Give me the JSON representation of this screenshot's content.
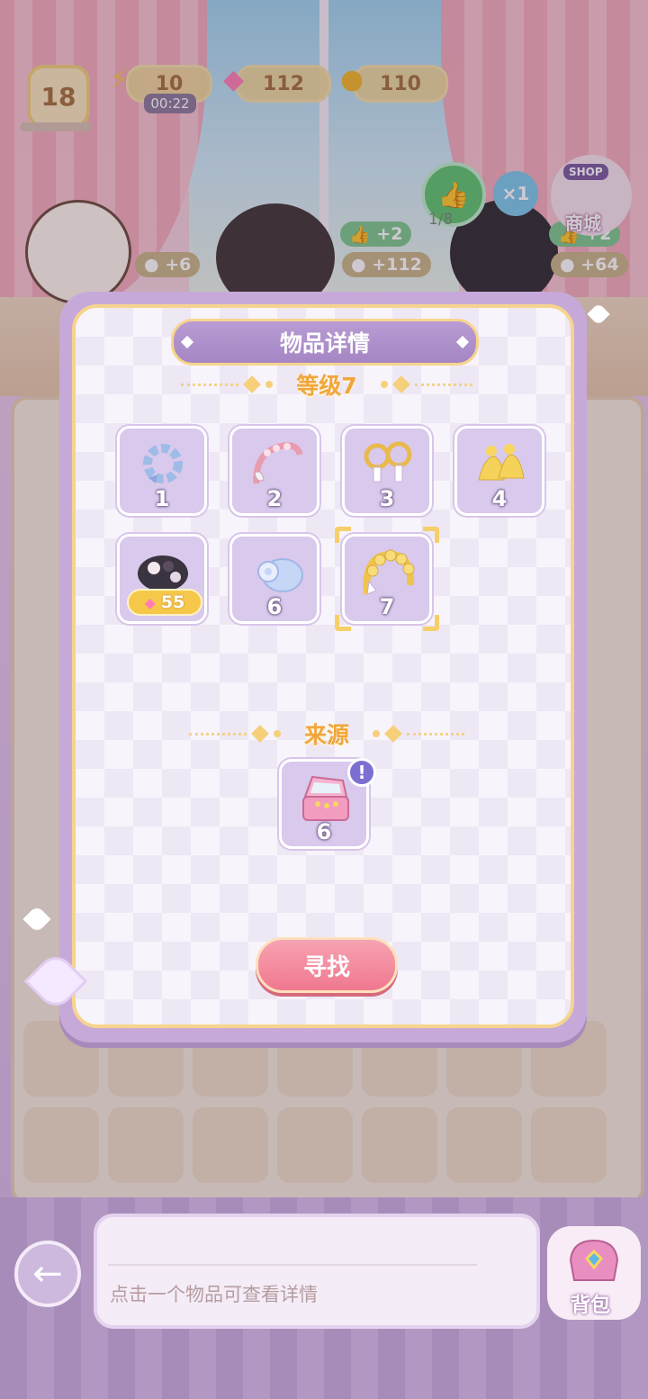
{
  "hud": {
    "level": "18",
    "energy": "10",
    "energy_timer": "00:22",
    "gems": "112",
    "coins": "110",
    "likes_progress": "1/8",
    "multiplier": "×1",
    "shop_badge": "SHOP",
    "shop_label": "商城"
  },
  "scene": {
    "cat_coin_bonus": "+6",
    "char1_like_bonus": "+2",
    "char1_coin_bonus": "+112",
    "char2_like_bonus": "+2",
    "char2_coin_bonus": "+64"
  },
  "modal": {
    "title": "物品详情",
    "level_heading": "等级7",
    "items": [
      {
        "level": "1",
        "icon": "blue-hair-scrunchie-icon"
      },
      {
        "level": "2",
        "icon": "pink-pearl-headband-icon"
      },
      {
        "level": "3",
        "icon": "pearl-earrings-icon"
      },
      {
        "level": "4",
        "icon": "gold-tassel-earrings-icon"
      },
      {
        "level": "",
        "icon": "black-lace-headpiece-icon",
        "locked": true,
        "price": "55"
      },
      {
        "level": "6",
        "icon": "blue-rose-hair-clip-icon"
      },
      {
        "level": "7",
        "icon": "gold-flower-crown-icon",
        "selected": true
      }
    ],
    "source_heading": "来源",
    "source": {
      "level": "6",
      "icon": "pink-jewelry-box-icon"
    },
    "find_button": "寻找"
  },
  "bottom": {
    "hint": "点击一个物品可查看详情",
    "bag_label": "背包"
  },
  "colors": {
    "accent_gold": "#f0a63c",
    "modal_purple": "#c6a9d8",
    "find_button_pink": "#f0788f",
    "gem_pink": "#ff7fb3"
  }
}
